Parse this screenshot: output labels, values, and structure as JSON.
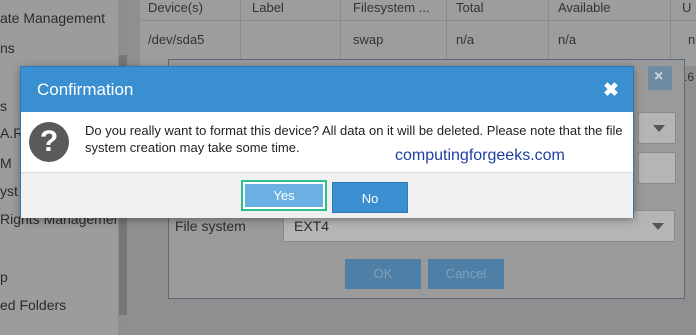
{
  "sidebar": {
    "items": [
      {
        "label": "ate Management"
      },
      {
        "label": "ns"
      },
      {
        "label": "s"
      },
      {
        "label": "A.R."
      },
      {
        "label": "M"
      },
      {
        "label": "yst"
      },
      {
        "label": "Rights Management"
      },
      {
        "label": "p"
      },
      {
        "label": "ed Folders"
      }
    ]
  },
  "grid": {
    "columns": [
      "Device(s)",
      "Label",
      "Filesystem ...",
      "Total",
      "Available",
      "U"
    ],
    "rows": [
      [
        "/dev/sda5",
        "",
        "swap",
        "n/a",
        "n/a",
        "n"
      ]
    ],
    "partial_value": ".6"
  },
  "background_dialog": {
    "filesystem_label": "File system",
    "filesystem_value": "EXT4",
    "ok_label": "OK",
    "cancel_label": "Cancel"
  },
  "modal": {
    "title": "Confirmation",
    "message": "Do you really want to format this device? All data on it will be deleted. Please note that the file system creation may take some time.",
    "yes_label": "Yes",
    "no_label": "No",
    "header_color": "#3a8fd0"
  },
  "watermark": "computingforgeeks.com"
}
